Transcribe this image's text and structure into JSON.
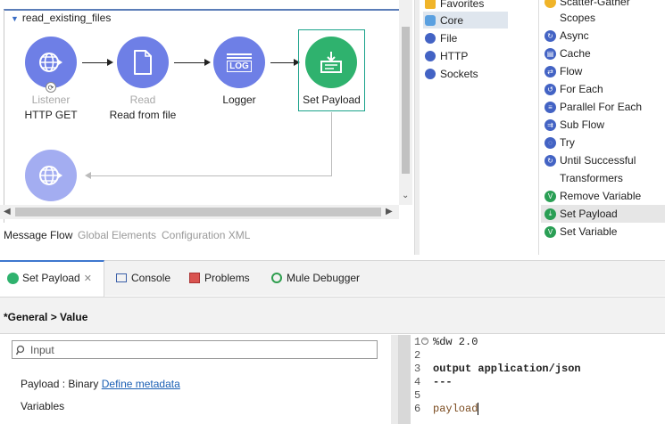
{
  "flow": {
    "title": "read_existing_files",
    "nodes": [
      {
        "type": "Listener",
        "label": "HTTP GET"
      },
      {
        "type": "Read",
        "label": "Read from file"
      },
      {
        "type": "",
        "label": "Logger"
      },
      {
        "type": "",
        "label": "Set Payload"
      }
    ],
    "logger_icon_text": "LOG"
  },
  "canvas_tabs": [
    "Message Flow",
    "Global Elements",
    "Configuration XML"
  ],
  "palette": {
    "modules": [
      "Favorites",
      "Core",
      "File",
      "HTTP",
      "Sockets"
    ],
    "selected_module": "Core",
    "items": [
      {
        "label": "Scatter-Gather",
        "kind": "item"
      },
      {
        "label": "Scopes",
        "kind": "category"
      },
      {
        "label": "Async",
        "kind": "item"
      },
      {
        "label": "Cache",
        "kind": "item"
      },
      {
        "label": "Flow",
        "kind": "item"
      },
      {
        "label": "For Each",
        "kind": "item"
      },
      {
        "label": "Parallel For Each",
        "kind": "item"
      },
      {
        "label": "Sub Flow",
        "kind": "item"
      },
      {
        "label": "Try",
        "kind": "item"
      },
      {
        "label": "Until Successful",
        "kind": "item"
      },
      {
        "label": "Transformers",
        "kind": "category"
      },
      {
        "label": "Remove Variable",
        "kind": "item"
      },
      {
        "label": "Set Payload",
        "kind": "item",
        "selected": true
      },
      {
        "label": "Set Variable",
        "kind": "item"
      }
    ]
  },
  "bottom_tabs": [
    {
      "label": "Set Payload",
      "active": true,
      "close": "✕"
    },
    {
      "label": "Console"
    },
    {
      "label": "Problems"
    },
    {
      "label": "Mule Debugger"
    }
  ],
  "properties": {
    "section_title": "*General > Value",
    "search_placeholder": "Input",
    "payload_prefix": "Payload : Binary",
    "payload_link": "Define metadata",
    "variables_label": "Variables"
  },
  "editor": {
    "lines": [
      {
        "n": "1",
        "text": "%dw 2.0"
      },
      {
        "n": "2",
        "text": ""
      },
      {
        "n": "3",
        "text": "output application/json"
      },
      {
        "n": "4",
        "text": "---"
      },
      {
        "n": "5",
        "text": ""
      },
      {
        "n": "6",
        "text": "payload"
      }
    ]
  },
  "colors": {
    "connector_blue": "#6e7fe6",
    "set_payload_green": "#2fb26e",
    "active_tab_accent": "#3e77cf",
    "link_blue": "#1a5fb4"
  }
}
